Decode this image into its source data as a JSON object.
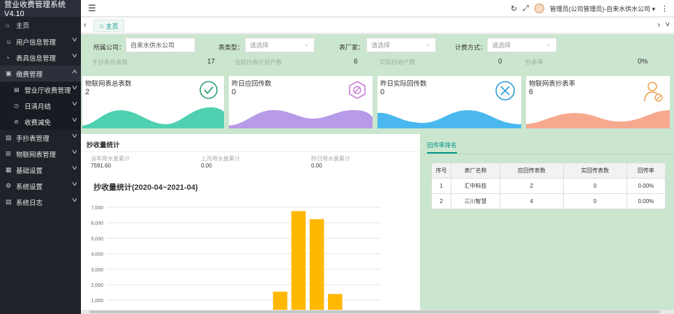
{
  "app": {
    "brand": "营业收费管理系统 V4.10"
  },
  "sidebar": {
    "items": [
      {
        "label": "主页",
        "icon": "home-icon"
      },
      {
        "label": "用户信息管理",
        "icon": "user-icon"
      },
      {
        "label": "表具信息管理",
        "icon": "meter-icon"
      },
      {
        "label": "缴费管理",
        "icon": "payment-icon"
      },
      {
        "label": "营业厅收费管理",
        "icon": "doc-icon"
      },
      {
        "label": "日清月结",
        "icon": "clock-icon"
      },
      {
        "label": "收费减免",
        "icon": "discount-icon"
      },
      {
        "label": "手抄表管理",
        "icon": "doc-icon"
      },
      {
        "label": "物联网表管理",
        "icon": "iot-icon"
      },
      {
        "label": "基础设置",
        "icon": "grid-icon"
      },
      {
        "label": "系统设置",
        "icon": "gear-icon"
      },
      {
        "label": "系统日志",
        "icon": "log-icon"
      }
    ]
  },
  "header": {
    "user": "管理员(公司管理员)-自来水供水公司"
  },
  "tabs": {
    "home": "主页"
  },
  "filters": {
    "company_label": "所属公司：",
    "company_value": "自来水供水公司",
    "meter_type_label": "表类型：",
    "meter_type_placeholder": "请选择",
    "manufacturer_label": "表厂家：",
    "manufacturer_placeholder": "请选择",
    "billing_label": "计费方式：",
    "billing_placeholder": "请选择"
  },
  "stats": [
    {
      "label": "手抄表总表数",
      "value": "17"
    },
    {
      "label": "当前抄表计划户数",
      "value": "6"
    },
    {
      "label": "实际抄收户数",
      "value": "0"
    },
    {
      "label": "抄表率",
      "value": "0%"
    }
  ],
  "cards": [
    {
      "title": "物联网表总表数",
      "value": "2",
      "icon": "check-circle-icon",
      "color": "#4fd0b0"
    },
    {
      "title": "昨日应回传数",
      "value": "0",
      "icon": "hexagon-block-icon",
      "color": "#b79be8"
    },
    {
      "title": "昨日实际回传数",
      "value": "0",
      "icon": "x-circle-icon",
      "color": "#4ab8ee"
    },
    {
      "title": "物联网表抄表率",
      "value": "6",
      "icon": "user-block-icon",
      "color": "#f7a98f"
    }
  ],
  "panel": {
    "title": "抄收量统计",
    "usage": [
      {
        "label": "当年用水量累计",
        "value": "7591.60"
      },
      {
        "label": "上月用水量累计",
        "value": "0.00"
      },
      {
        "label": "昨日用水量累计",
        "value": "0.00"
      }
    ]
  },
  "chart_data": {
    "type": "bar",
    "title": "抄收量统计(2020-04~2021-04)",
    "yticks": [
      "1,000",
      "2,000",
      "3,000",
      "4,000",
      "5,000",
      "6,000",
      "7,000"
    ],
    "ylim": [
      0,
      7000
    ],
    "grid": true,
    "values": [
      0,
      0,
      0,
      0,
      0,
      0,
      0,
      0,
      0,
      1550,
      6750,
      6230,
      1400,
      0,
      0
    ],
    "color": "#ffb800"
  },
  "ranking": {
    "tab": "回传率排名",
    "columns": [
      "序号",
      "表厂名称",
      "应回传表数",
      "实回传表数",
      "回传率"
    ],
    "rows": [
      [
        "1",
        "汇中科技",
        "2",
        "0",
        "0.00%"
      ],
      [
        "2",
        "三川智慧",
        "4",
        "0",
        "0.00%"
      ]
    ]
  }
}
